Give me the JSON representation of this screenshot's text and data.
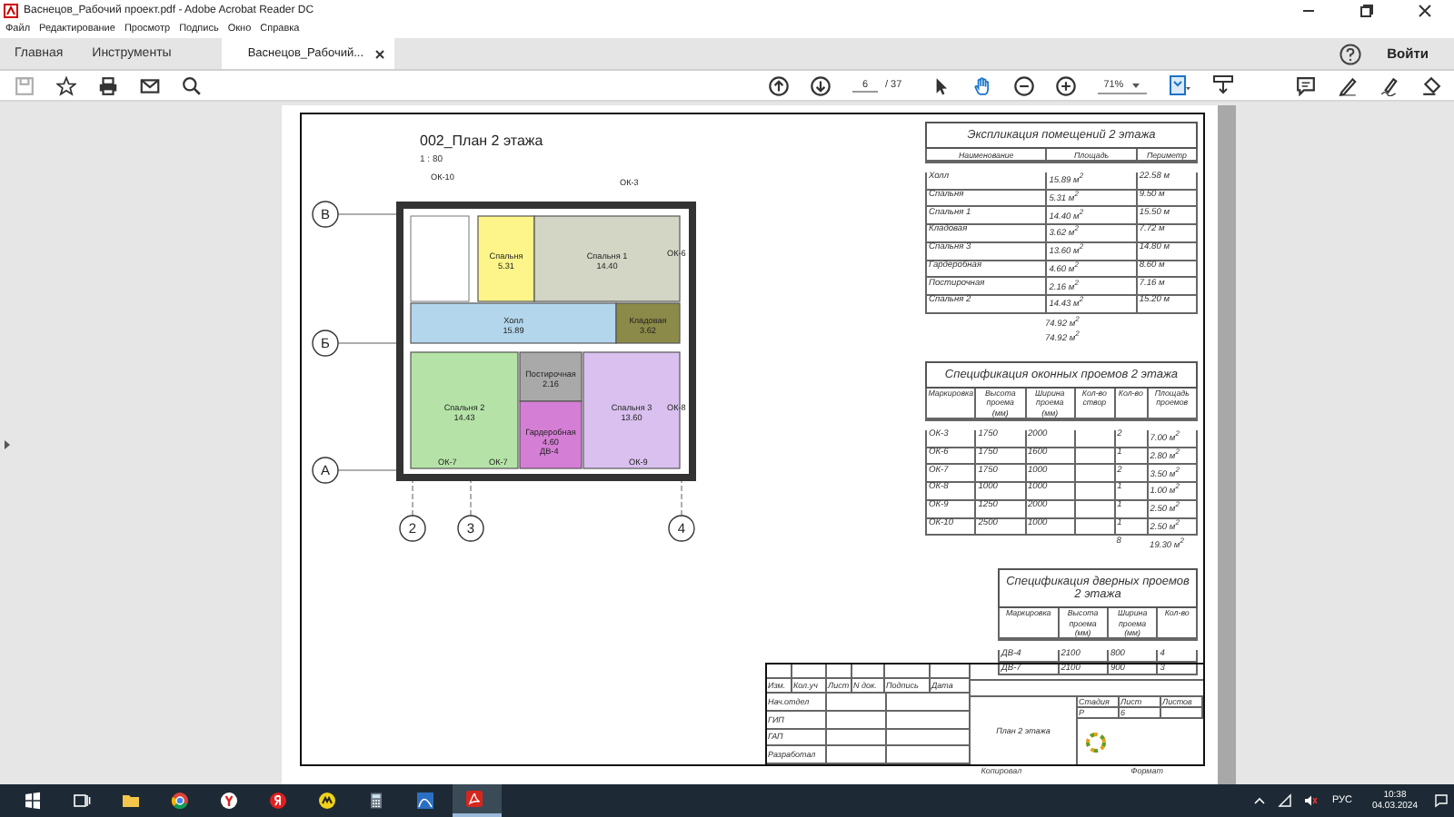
{
  "window": {
    "title": "Васнецов_Рабочий проект.pdf - Adobe Acrobat Reader DC"
  },
  "menu": [
    "Файл",
    "Редактирование",
    "Просмотр",
    "Подпись",
    "Окно",
    "Справка"
  ],
  "tabs": [
    {
      "label": "Главная",
      "selected": false
    },
    {
      "label": "Инструменты",
      "selected": false
    },
    {
      "label": "Васнецов_Рабочий...",
      "selected": true
    }
  ],
  "account": {
    "label": "Войти"
  },
  "toolbar": {
    "page": "6",
    "page_count": "/ 37",
    "zoom": "71%"
  },
  "plan": {
    "title": "002_План 2 этажа",
    "scale": "1 : 80",
    "axes": [
      "В",
      "Б",
      "А",
      "2",
      "3",
      "4"
    ],
    "rooms": [
      {
        "name": "Спальня",
        "area": "5.31",
        "color": "#fdf58a"
      },
      {
        "name": "Спальня 1",
        "area": "14.40",
        "color": "#d3d6c4"
      },
      {
        "name": "Холл",
        "area": "15.89",
        "color": "#b3d6ec"
      },
      {
        "name": "Кладовая",
        "area": "3.62",
        "color": "#8c8a48"
      },
      {
        "name": "Спальня 2",
        "area": "14.43",
        "color": "#b5e3a7"
      },
      {
        "name": "Постирочная",
        "area": "2.16",
        "color": "#a9a9a9"
      },
      {
        "name": "Гардеробная",
        "area": "4.60",
        "color": "#d57ed5"
      },
      {
        "name": "Спальня 3",
        "area": "13.60",
        "color": "#d9c0ef"
      }
    ],
    "marks": [
      "ОК-10",
      "ОК-3",
      "ОК-6",
      "ОК-7",
      "ОК-7",
      "ОК-9",
      "ОК-8",
      "ДВ-4"
    ]
  },
  "explication": {
    "title": "Экспликация помещений 2 этажа",
    "columns": [
      "Наименование",
      "Площадь",
      "Периметр"
    ],
    "rows": [
      [
        "Холл",
        "15.89 м$^{2}$",
        "22.58 м"
      ],
      [
        "Спальня",
        "5.31 м$^{2}$",
        "9.50 м"
      ],
      [
        "Спальня 1",
        "14.40 м$^{2}$",
        "15.50 м"
      ],
      [
        "Кладовая",
        "3.62 м$^{2}$",
        "7.72 м"
      ],
      [
        "Спальня 3",
        "13.60 м$^{2}$",
        "14.80 м"
      ],
      [
        "Гардеробная",
        "4.60 м$^{2}$",
        "8.60 м"
      ],
      [
        "Постирочная",
        "2.16 м$^{2}$",
        "7.16 м"
      ],
      [
        "Спальня 2",
        "14.43 м$^{2}$",
        "15.20 м"
      ]
    ],
    "totals": [
      "74.92 м$^{2}$",
      "74.92 м$^{2}$"
    ]
  },
  "windows_spec": {
    "title": "Спецификация оконных проемов 2 этажа",
    "columns": [
      "Маркировка",
      "Высота проема (мм)",
      "Ширина проема (мм)",
      "Кол-во створ",
      "Кол-во",
      "Площадь проемов"
    ],
    "rows": [
      [
        "ОК-3",
        "1750",
        "2000",
        "2",
        "7.00 м$^{2}$"
      ],
      [
        "ОК-6",
        "1750",
        "1600",
        "1",
        "2.80 м$^{2}$"
      ],
      [
        "ОК-7",
        "1750",
        "1000",
        "2",
        "3.50 м$^{2}$"
      ],
      [
        "ОК-8",
        "1000",
        "1000",
        "1",
        "1.00 м$^{2}$"
      ],
      [
        "ОК-9",
        "1250",
        "2000",
        "1",
        "2.50 м$^{2}$"
      ],
      [
        "ОК-10",
        "2500",
        "1000",
        "1",
        "2.50 м$^{2}$"
      ]
    ],
    "totals": [
      "8",
      "19.30 м$^{2}$"
    ]
  },
  "doors_spec": {
    "title": "Спецификация дверных проемов 2 этажа",
    "columns": [
      "Маркировка",
      "Высота проема (мм)",
      "Ширина проема (мм)",
      "Кол-во"
    ],
    "rows": [
      [
        "ДВ-4",
        "2100",
        "800",
        "4"
      ],
      [
        "ДВ-7",
        "2100",
        "900",
        "3"
      ]
    ]
  },
  "stamp": {
    "headers": [
      "Изм.",
      "Кол.уч",
      "Лист",
      "N док.",
      "Подпись",
      "Дата"
    ],
    "roles": [
      "Нач.отдел",
      "ГИП",
      "ГАП",
      "Разработал"
    ],
    "sheet_title": "План 2 этажа",
    "stage_headers": [
      "Стадия",
      "Лист",
      "Листов"
    ],
    "stage_values": [
      "Р",
      "6"
    ],
    "footer": [
      "Копировал",
      "Формат"
    ]
  },
  "taskbar": {
    "language": "РУС",
    "time": "10:38",
    "date": "04.03.2024"
  }
}
